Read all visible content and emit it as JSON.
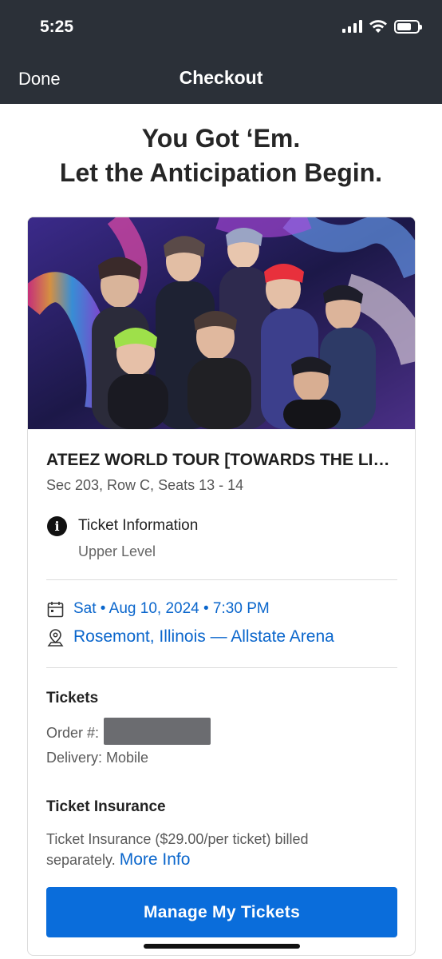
{
  "status_bar": {
    "time": "5:25"
  },
  "nav": {
    "done_label": "Done",
    "title": "Checkout"
  },
  "headline": {
    "line1": "You Got ‘Em.",
    "line2": "Let the Anticipation Begin."
  },
  "event": {
    "title": "ATEEZ WORLD TOUR [TOWARDS THE LIGHT : WILL TO POWER]",
    "seats": "Sec 203, Row C, Seats 13 - 14"
  },
  "ticket_info": {
    "label": "Ticket Information",
    "level": "Upper Level"
  },
  "schedule": {
    "datetime": "Sat • Aug 10, 2024 • 7:30 PM",
    "venue": "Rosemont, Illinois — Allstate Arena"
  },
  "tickets": {
    "heading": "Tickets",
    "order_label": "Order #:",
    "delivery": "Delivery: Mobile"
  },
  "insurance": {
    "heading": "Ticket Insurance",
    "text": "Ticket Insurance ($29.00/per ticket) billed separately.",
    "more_info": "More Info"
  },
  "cta": {
    "label": "Manage My Tickets"
  },
  "colors": {
    "nav_bg": "#2b3038",
    "link": "#0a66cc",
    "button": "#0a6ddb"
  },
  "icons": [
    "signal-icon",
    "wifi-icon",
    "battery-icon",
    "info-icon",
    "calendar-icon",
    "location-pin-icon"
  ]
}
